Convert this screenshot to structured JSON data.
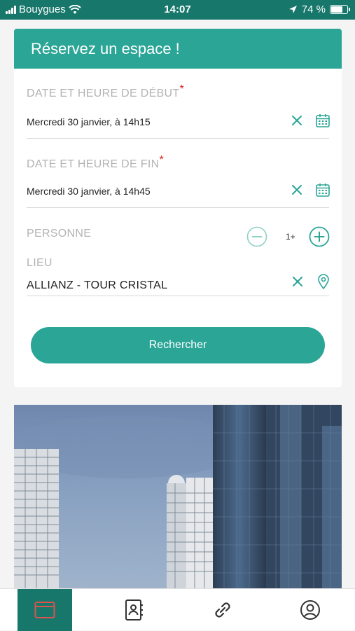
{
  "status_bar": {
    "carrier": "Bouygues",
    "time": "14:07",
    "battery_percent": "74 %",
    "battery_level": 0.74
  },
  "booking_form": {
    "title": "Réservez un espace !",
    "start": {
      "label": "DATE ET HEURE DE DÉBUT",
      "required_mark": "*",
      "value": "Mercredi 30 janvier, à 14h15"
    },
    "end": {
      "label": "DATE ET HEURE DE FIN",
      "required_mark": "*",
      "value": "Mercredi 30 janvier, à 14h45"
    },
    "persons": {
      "label": "PERSONNE",
      "count": "1+"
    },
    "location": {
      "label": "LIEU",
      "value": "ALLIANZ - TOUR CRISTAL"
    },
    "search_label": "Rechercher"
  },
  "bottom_nav": {
    "items": [
      {
        "name": "calendar",
        "icon": "calendar-icon",
        "active": true
      },
      {
        "name": "contacts",
        "icon": "contact-book-icon",
        "active": false
      },
      {
        "name": "links",
        "icon": "link-icon",
        "active": false
      },
      {
        "name": "profile",
        "icon": "user-circle-icon",
        "active": false
      }
    ]
  },
  "colors": {
    "brand_dark": "#17776b",
    "brand": "#2aa596",
    "required": "#e02020"
  }
}
